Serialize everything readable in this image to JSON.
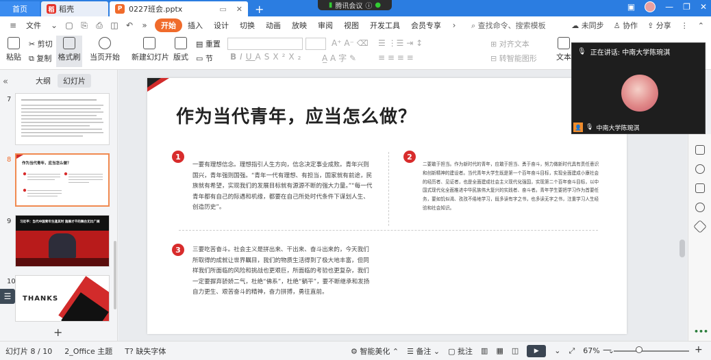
{
  "titlebar": {
    "home_tab": "首页",
    "docer_tab": "稻壳",
    "file_tab": "0227班会.pptx",
    "meeting": "腾讯会议"
  },
  "menubar": {
    "file": "文件",
    "items": [
      "开始",
      "插入",
      "设计",
      "切换",
      "动画",
      "放映",
      "审阅",
      "视图",
      "开发工具",
      "会员专享"
    ],
    "search": "查找命令、搜索模板",
    "sync": "未同步",
    "collab": "协作",
    "share": "分享"
  },
  "ribbon": {
    "paste": "粘贴",
    "cut": "剪切",
    "copy": "复制",
    "format_painter": "格式刷",
    "from_current": "当页开始",
    "new_slide": "新建幻灯片",
    "layout": "版式",
    "reset": "重置",
    "section": "节",
    "align_text": "对齐文本",
    "smartart": "转智能图形",
    "textbox": "文本"
  },
  "leftpanel": {
    "outline_tab": "大纲",
    "slides_tab": "幻灯片",
    "thumbs": [
      {
        "num": "7"
      },
      {
        "num": "8",
        "title": "作为当代青年，应当怎么做？"
      },
      {
        "num": "9",
        "title": "习近平：当代中国青年生逢其时 施展才干的舞台无比广阔"
      },
      {
        "num": "10",
        "title": "THANKS"
      }
    ]
  },
  "slide": {
    "title": "作为当代青年，应当怎么做？",
    "points": [
      {
        "n": "1",
        "text": "一要有理想信念。理想指引人生方向，信念决定事业成败。青年兴则国兴，青年强则国强。“青年一代有理想、有担当，国家就有前途，民族就有希望，实现我们的发展目标就有源源不断的强大力量。”“每一代青年都有自己的际遇和机缘，都要在自己所处时代条件下谋划人生、创造历史”。"
      },
      {
        "n": "2",
        "text": "二要敢于担当。作为新时代的青年，应敢于担当、勇于奋斗，努力做新时代具有责任意识和创新精神的建设者。当代青年大学生既是第一个百年奋斗目标，实现全面建成小康社会的经历者、见证者，也是全面建成社会主义现代化强国，实现第二个百年奋斗目标，以中国式现代化全面推进中华民族伟大复兴的实践者、奋斗者。青年学生要把学习作为首要任务，要如饥似渴、孜孜不倦地学习，既多读有字之书，也多读无字之书，注重学习人生经验和社会知识。"
      },
      {
        "n": "3",
        "text": "三要吃苦奋斗。社会主义是拼出来、干出来、奋斗出来的，今天我们所取得的成就让世界瞩目，我们的物质生活得到了极大地丰富，但同样我们所面临的风险和挑战也更艰巨，所面临的考验也更复杂，我们一定要摒弃骄娇二气，杜绝“佛系”，杜绝“躺平”，要不断继承和发扬自力更生、艰苦奋斗的精神，奋力拼搏，勇往直前。"
      }
    ]
  },
  "video": {
    "speaking": "正在讲话: 中南大学陈琬淇",
    "name": "中南大学陈琬淇"
  },
  "statusbar": {
    "slide_info": "幻灯片 8 / 10",
    "theme": "2_Office 主题",
    "missing_font": "缺失字体",
    "beautify": "智能美化",
    "notes": "备注",
    "comments": "批注",
    "zoom": "67%"
  }
}
